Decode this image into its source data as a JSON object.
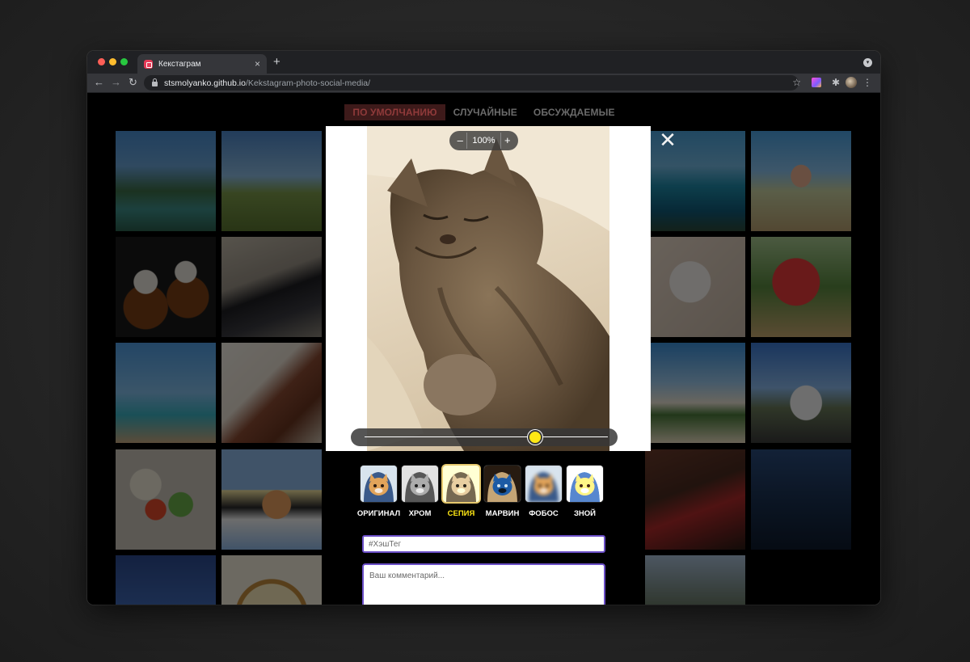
{
  "browser": {
    "tab_title": "Кекстаграм",
    "tab_close": "×",
    "new_tab": "+",
    "url_host": "stsmolyanko.github.io",
    "url_path": "/Kekstagram-photo-social-media/",
    "back": "←",
    "forward": "→",
    "reload": "↻",
    "bookmark": "☆",
    "extensions": "✱",
    "menu": "⋮"
  },
  "filters": [
    {
      "label": "ПО УМОЛЧАНИЮ",
      "active": true
    },
    {
      "label": "СЛУЧАЙНЫЕ",
      "active": false
    },
    {
      "label": "ОБСУЖДАЕМЫЕ",
      "active": false
    }
  ],
  "upload": {
    "scale": {
      "minus": "–",
      "value": "100%",
      "plus": "+"
    },
    "close": "✕",
    "effect_level": 0.7,
    "effects": [
      {
        "label": "ОРИГИНАЛ",
        "filter": "none",
        "selected": false
      },
      {
        "label": "ХРОМ",
        "filter": "grayscale(1)",
        "selected": false
      },
      {
        "label": "СЕПИЯ",
        "filter": "sepia(1)",
        "selected": true
      },
      {
        "label": "МАРВИН",
        "filter": "invert(1)",
        "selected": false
      },
      {
        "label": "ФОБОС",
        "filter": "blur(2px)",
        "selected": false
      },
      {
        "label": "ЗНОЙ",
        "filter": "brightness(1.5)",
        "selected": false
      }
    ],
    "hashtag_placeholder": "#ХэшТег",
    "comment_placeholder": "Ваш комментарий..."
  },
  "colors": {
    "accent_yellow": "#ffe814",
    "input_border": "#6b4fc8",
    "active_filter_bg": "#3d1a1a"
  }
}
